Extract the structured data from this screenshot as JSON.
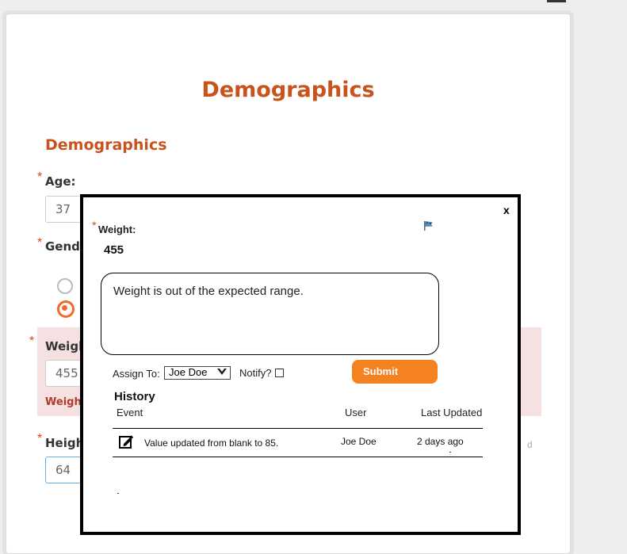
{
  "page": {
    "title": "Demographics",
    "section_title": "Demographics"
  },
  "form": {
    "age": {
      "label": "Age:",
      "value": "37"
    },
    "gender": {
      "label": "Gender:"
    },
    "weight": {
      "label": "Weight:",
      "value": "455",
      "warning": "Weight is out of the expected range."
    },
    "height": {
      "label": "Height:",
      "value": "64",
      "note": "d"
    }
  },
  "modal": {
    "close_label": "x",
    "field_label": "Weight:",
    "field_value": "455",
    "comment": "Weight is out of the expected range.",
    "assign_label": "Assign To:",
    "assign_value": "Joe Doe",
    "notify_label": "Notify?",
    "submit_label": "Submit",
    "history": {
      "title": "History",
      "columns": [
        "Event",
        "User",
        "Last Updated"
      ],
      "rows": [
        {
          "event": "Value updated from blank to 85.",
          "user": "Joe Doe",
          "updated": "2 days ago"
        }
      ]
    }
  },
  "colors": {
    "accent": "#c8531d",
    "submit": "#f58220",
    "warning_bg": "#f5e1e1"
  },
  "icons": [
    "flag-icon",
    "edit-icon",
    "chevron-down-icon"
  ]
}
